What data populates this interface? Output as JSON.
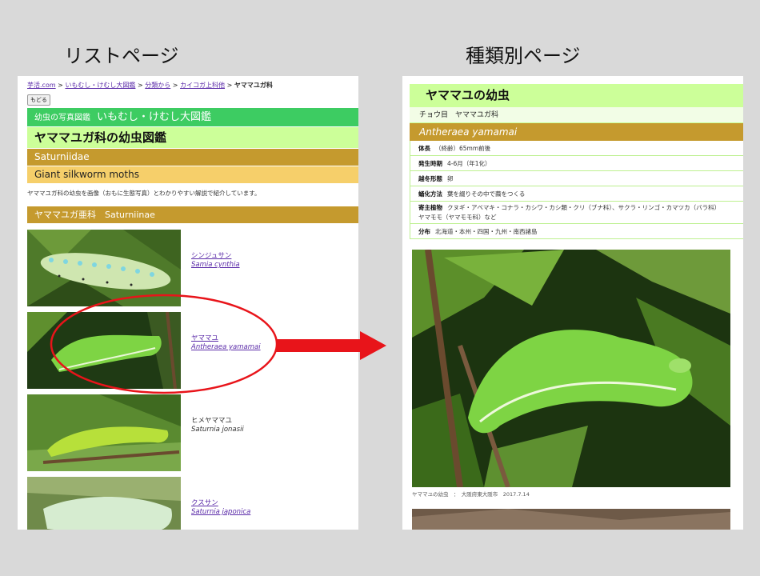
{
  "headings": {
    "left": "リストページ",
    "right": "種類別ページ"
  },
  "list_page": {
    "breadcrumbs": [
      {
        "label": "芋活.com",
        "link": true
      },
      {
        "label": "いもむし・けむし大図鑑",
        "link": true
      },
      {
        "label": "分類から",
        "link": true
      },
      {
        "label": "カイコガ上科他",
        "link": true
      },
      {
        "label": "ヤママユガ科",
        "link": false
      }
    ],
    "back_button": "もどる",
    "zukan_prefix": "幼虫の写真図鑑",
    "zukan_name": "いもむし・けむし大図鑑",
    "page_title": "ヤママユガ科の幼虫図鑑",
    "latin_family": "Saturniidae",
    "english_name": "Giant silkworm moths",
    "intro_text": "ヤママユガ科の幼虫を画像（おもに生態写真）とわかりやすい解説で紹介しています。",
    "subfamily_header": "ヤママユガ亜科　Saturniinae",
    "species": [
      {
        "jp": "シンジュサン",
        "latin": "Samia cynthia",
        "link": true
      },
      {
        "jp": "ヤママユ",
        "latin": "Antheraea yamamai",
        "link": true
      },
      {
        "jp": "ヒメヤママユ",
        "latin": "Saturnia jonasii",
        "link": false
      },
      {
        "jp": "クスサン",
        "latin": "Saturnia japonica",
        "link": true
      }
    ]
  },
  "detail_page": {
    "title": "ヤママユの幼虫",
    "order": "チョウ目　ヤママユガ科",
    "latin": "Antheraea yamamai",
    "info": [
      {
        "label": "体長",
        "value": "（終齢）65mm前後"
      },
      {
        "label": "発生時期",
        "value": "4-6月（年1化）"
      },
      {
        "label": "越冬形態",
        "value": "卵"
      },
      {
        "label": "蛹化方法",
        "value": "葉を綴りその中で繭をつくる"
      },
      {
        "label": "寄主植物",
        "value": "クヌギ・アベマキ・コナラ・カシワ・カシ類・クリ（ブナ科）、サクラ・リンゴ・カマツカ（バラ科）",
        "value2": "ヤマモモ（ヤマモモ科）など"
      },
      {
        "label": "分布",
        "value": "北海道・本州・四国・九州・南西諸島"
      }
    ],
    "caption": "ヤママユの幼虫　：　大阪府東大阪市　2017.7.14"
  },
  "colors": {
    "annotation": "#e8141a",
    "green_bar": "#3dcc62",
    "light_green": "#ccff99",
    "brown": "#c59a2e",
    "yellow": "#f6cf6a"
  }
}
